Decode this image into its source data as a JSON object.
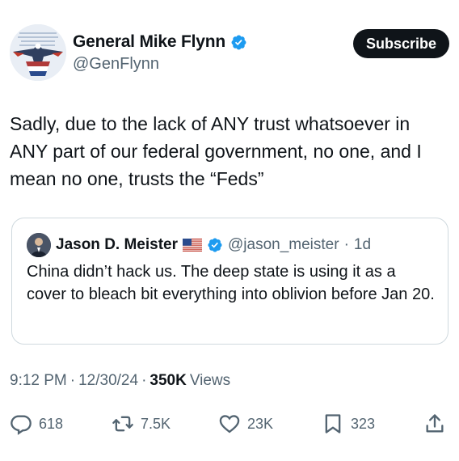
{
  "author": {
    "display_name": "General Mike Flynn",
    "handle": "@GenFlynn",
    "avatar_icon": "eagle-flag-avatar",
    "verified": true
  },
  "subscribe_label": "Subscribe",
  "tweet_text": "Sadly, due to the lack of ANY trust whatsoever in ANY part of our federal government, no one, and I mean no one, trusts the “Feds”",
  "quoted": {
    "display_name": "Jason D. Meister",
    "flag_icon": "us-flag-icon",
    "verified": true,
    "handle": "@jason_meister",
    "time": "1d",
    "text": "China didn’t hack us. The deep state is using it as a cover to bleach bit everything into oblivion before Jan 20."
  },
  "meta": {
    "time": "9:12 PM",
    "date": "12/30/24",
    "views_count": "350K",
    "views_label": "Views"
  },
  "actions": {
    "replies": "618",
    "reposts": "7.5K",
    "likes": "23K",
    "bookmarks": "323"
  },
  "colors": {
    "text": "#0f1419",
    "secondary": "#536471",
    "verified_blue": "#1d9bf0",
    "border": "#cfd9de"
  }
}
